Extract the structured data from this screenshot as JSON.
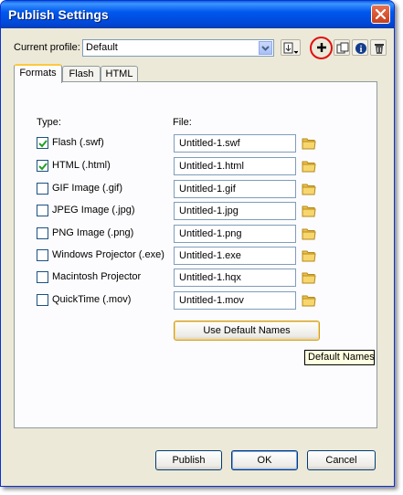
{
  "window": {
    "title": "Publish Settings"
  },
  "profile": {
    "label": "Current profile:",
    "value": "Default"
  },
  "toolbar": [
    "import-export-icon",
    "plus-icon",
    "duplicate-icon",
    "info-icon",
    "trash-icon"
  ],
  "tabs": [
    {
      "label": "Formats",
      "active": true
    },
    {
      "label": "Flash",
      "active": false
    },
    {
      "label": "HTML",
      "active": false
    }
  ],
  "formats": {
    "type_header": "Type:",
    "file_header": "File:",
    "rows": [
      {
        "label": "Flash  (.swf)",
        "file": "Untitled-1.swf",
        "checked": true
      },
      {
        "label": "HTML  (.html)",
        "file": "Untitled-1.html",
        "checked": true
      },
      {
        "label": "GIF Image (.gif)",
        "file": "Untitled-1.gif",
        "checked": false
      },
      {
        "label": "JPEG Image (.jpg)",
        "file": "Untitled-1.jpg",
        "checked": false
      },
      {
        "label": "PNG Image (.png)",
        "file": "Untitled-1.png",
        "checked": false
      },
      {
        "label": "Windows Projector (.exe)",
        "file": "Untitled-1.exe",
        "checked": false
      },
      {
        "label": "Macintosh Projector",
        "file": "Untitled-1.hqx",
        "checked": false
      },
      {
        "label": "QuickTime (.mov)",
        "file": "Untitled-1.mov",
        "checked": false
      }
    ],
    "default_names_button": "Use Default Names",
    "tooltip": "Default Names"
  },
  "footer": {
    "publish": "Publish",
    "ok": "OK",
    "cancel": "Cancel"
  },
  "colors": {
    "titlebar": "#0058ee",
    "highlight_ring": "#e01010",
    "dialog_bg": "#ece9d8"
  }
}
